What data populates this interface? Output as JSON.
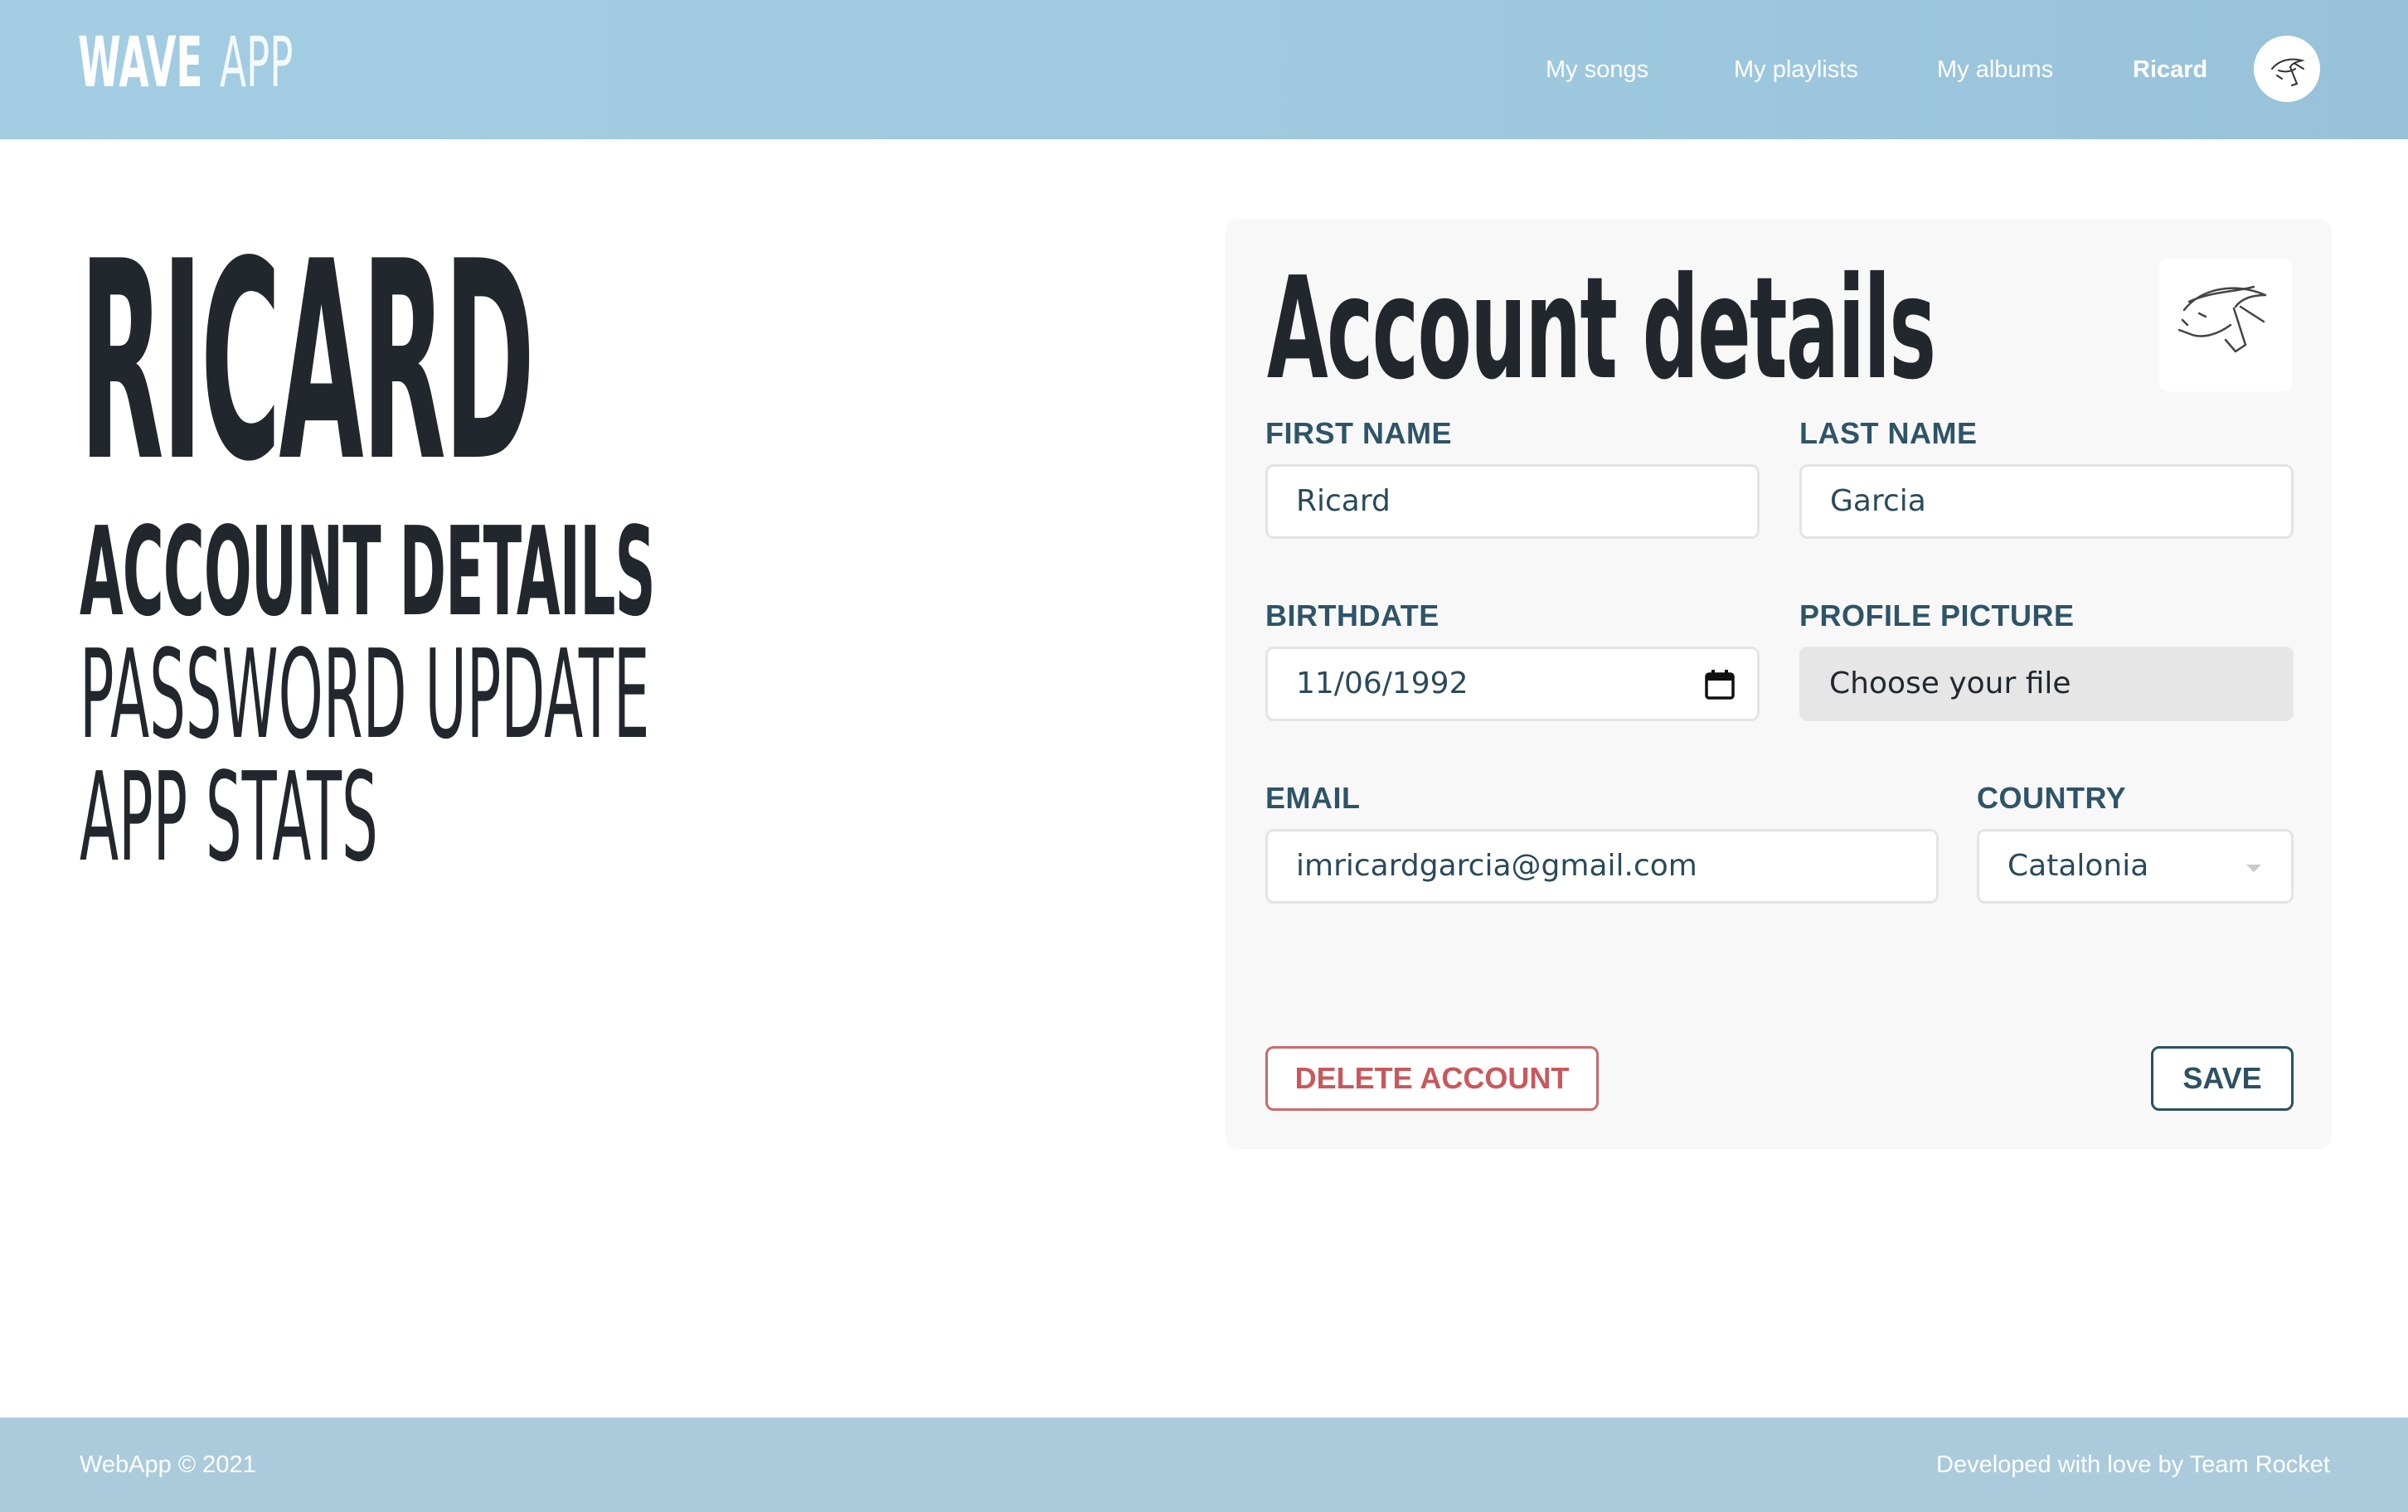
{
  "header": {
    "logo_bold": "WAVE",
    "logo_light": "APP",
    "nav": [
      {
        "label": "My songs"
      },
      {
        "label": "My playlists"
      },
      {
        "label": "My albums"
      },
      {
        "label": "Ricard"
      }
    ]
  },
  "sidebar": {
    "title": "RICARD",
    "items": [
      {
        "label": "ACCOUNT DETAILS",
        "active": true
      },
      {
        "label": "PASSWORD UPDATE",
        "active": false
      },
      {
        "label": "APP STATS",
        "active": false
      }
    ]
  },
  "form": {
    "title": "Account details",
    "first_name": {
      "label": "FIRST NAME",
      "value": "Ricard"
    },
    "last_name": {
      "label": "LAST NAME",
      "value": "Garcia"
    },
    "birthdate": {
      "label": "BIRTHDATE",
      "value": "11/06/1992"
    },
    "profile_picture": {
      "label": "PROFILE PICTURE",
      "button": "Choose your file"
    },
    "email": {
      "label": "EMAIL",
      "value": "imricardgarcia@gmail.com"
    },
    "country": {
      "label": "COUNTRY",
      "value": "Catalonia"
    },
    "delete_label": "DELETE ACCOUNT",
    "save_label": "SAVE"
  },
  "footer": {
    "left": "WebApp © 2021",
    "right": "Developed with love by Team Rocket"
  },
  "colors": {
    "header_bg": "#a3cde2",
    "footer_bg": "#abcbdc",
    "label": "#2e5468",
    "delete": "#c9585c",
    "save": "#2d5064",
    "card_bg": "#f8f8f8"
  }
}
